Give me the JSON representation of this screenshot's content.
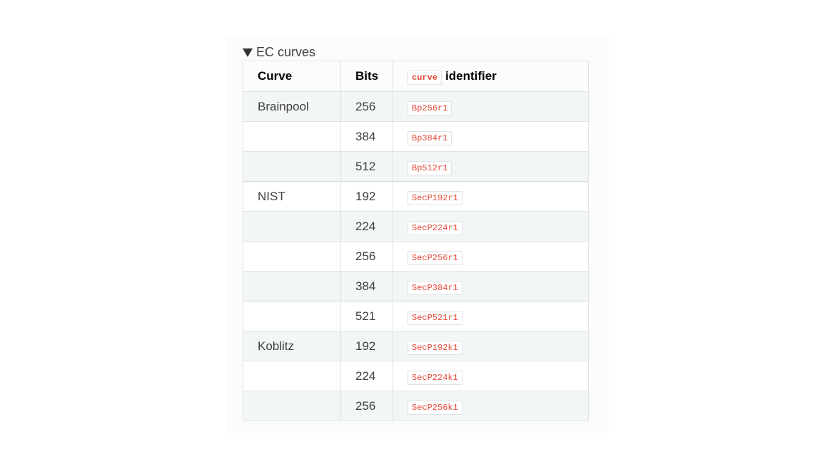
{
  "details": {
    "summary": "EC curves"
  },
  "table": {
    "headers": {
      "curve": "Curve",
      "bits": "Bits",
      "identifier_code": "curve",
      "identifier_text": "identifier"
    },
    "rows": [
      {
        "curve": "Brainpool",
        "bits": "256",
        "id": "Bp256r1"
      },
      {
        "curve": "",
        "bits": "384",
        "id": "Bp384r1"
      },
      {
        "curve": "",
        "bits": "512",
        "id": "Bp512r1"
      },
      {
        "curve": "NIST",
        "bits": "192",
        "id": "SecP192r1"
      },
      {
        "curve": "",
        "bits": "224",
        "id": "SecP224r1"
      },
      {
        "curve": "",
        "bits": "256",
        "id": "SecP256r1"
      },
      {
        "curve": "",
        "bits": "384",
        "id": "SecP384r1"
      },
      {
        "curve": "",
        "bits": "521",
        "id": "SecP521r1"
      },
      {
        "curve": "Koblitz",
        "bits": "192",
        "id": "SecP192k1"
      },
      {
        "curve": "",
        "bits": "224",
        "id": "SecP224k1"
      },
      {
        "curve": "",
        "bits": "256",
        "id": "SecP256k1"
      }
    ]
  }
}
